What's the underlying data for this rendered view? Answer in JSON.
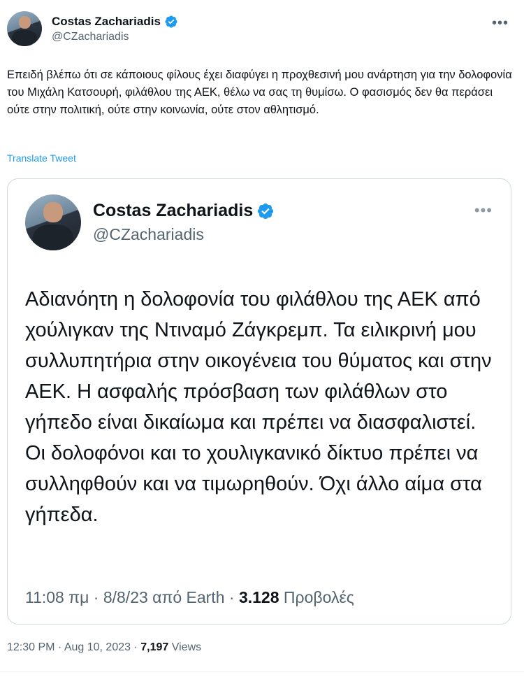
{
  "author": {
    "name": "Costas Zachariadis",
    "handle": "@CZachariadis",
    "verified": true,
    "avatar_icon": "profile-photo"
  },
  "tweet": {
    "text": "Επειδή βλέπω ότι σε κάποιους φίλους έχει διαφύγει η προχθεσινή μου ανάρτηση για την δολοφονία του Μιχάλη Κατσουρή, φιλάθλου της ΑΕΚ, θέλω να σας τη θυμίσω. Ο φασισμός δεν θα περάσει ούτε στην πολιτική, ούτε στην κοινωνία, ούτε στον αθλητισμό.",
    "translate_label": "Translate Tweet",
    "time": "12:30 PM",
    "date": "Aug 10, 2023",
    "views_count": "7,197",
    "views_label": "Views",
    "more_icon": "more-dots-icon"
  },
  "quoted_tweet": {
    "name": "Costas Zachariadis",
    "handle": "@CZachariadis",
    "verified": true,
    "text": "Αδιανόητη η δολοφονία του φιλάθλου της ΑΕΚ από χούλιγκαν της Ντιναμό Ζάγκρεμπ. Τα ειλικρινή μου συλλυπητήρια στην οικογένεια του θύματος και στην ΑΕΚ. Η ασφαλής πρόσβαση των φιλάθλων στο γήπεδο είναι δικαίωμα και πρέπει να διασφαλιστεί. Οι δολοφόνοι και το χουλιγκανικό δίκτυο πρέπει να συλληφθούν και να τιμωρηθούν. Όχι άλλο αίμα στα γήπεδα.",
    "time": "11:08 πμ",
    "date": "8/8/23",
    "source": "από Earth",
    "views_count": "3.128",
    "views_label": "Προβολές"
  },
  "colors": {
    "text": "#0f1419",
    "secondary": "#536471",
    "link": "#1d9bf0",
    "verified": "#1d9bf0",
    "border": "#cfd9de"
  }
}
